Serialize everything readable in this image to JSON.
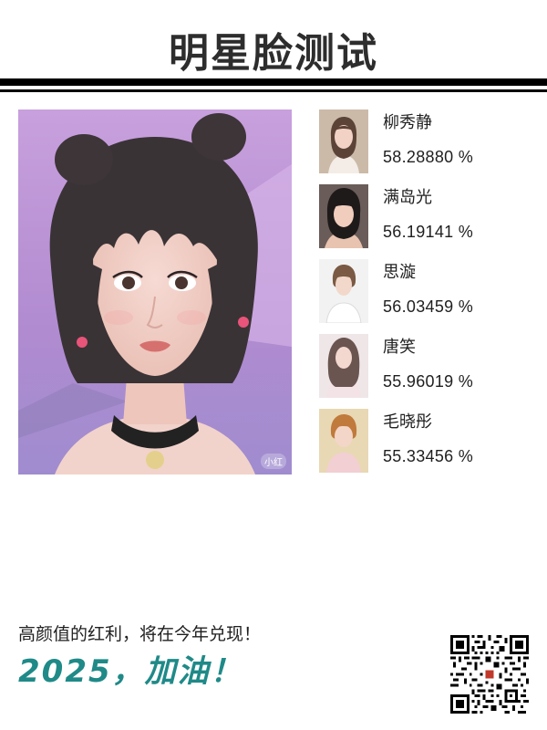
{
  "header": {
    "title": "明星脸测试"
  },
  "main_photo": {
    "watermark": "小红"
  },
  "matches": [
    {
      "name": "柳秀静",
      "score": "58.28880 %"
    },
    {
      "name": "满岛光",
      "score": "56.19141 %"
    },
    {
      "name": "思漩",
      "score": "56.03459 %"
    },
    {
      "name": "唐笑",
      "score": "55.96019 %"
    },
    {
      "name": "毛晓彤",
      "score": "55.33456 %"
    }
  ],
  "footer": {
    "tagline": "高颜值的红利，将在今年兑现！",
    "slogan": "2025，加油！"
  },
  "colors": {
    "accent": "#1f8a88",
    "rule": "#000000"
  }
}
